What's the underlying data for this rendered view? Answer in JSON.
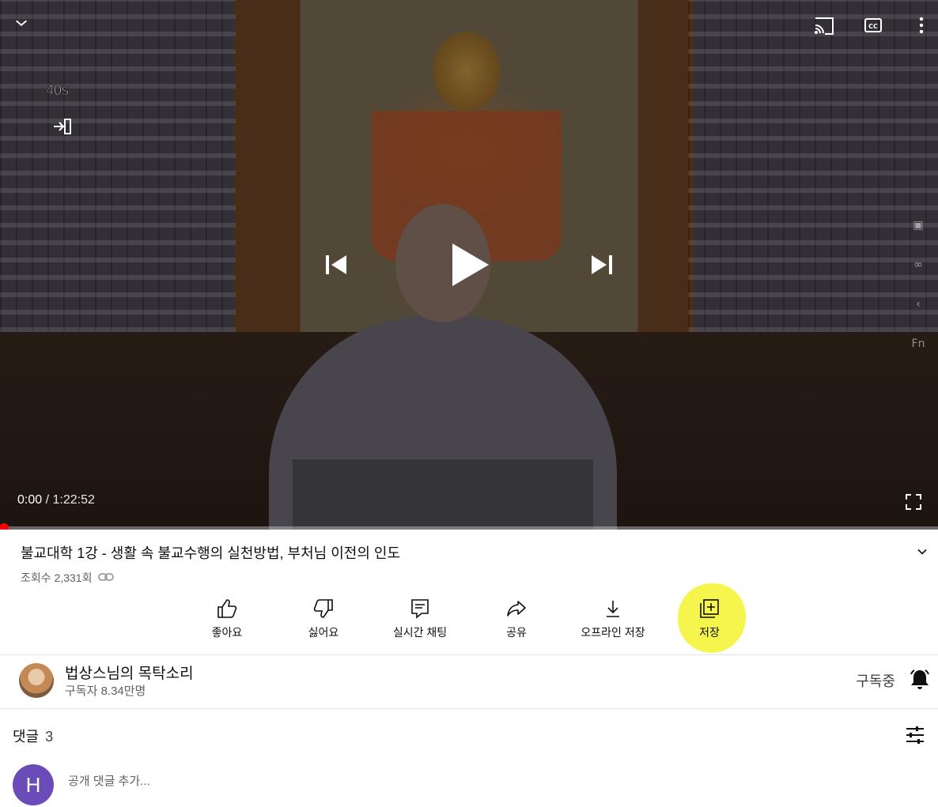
{
  "player": {
    "current_time": "0:00",
    "separator": " / ",
    "duration": "1:22:52",
    "seek_hint": "40s",
    "progress_fraction": 0.0,
    "icons": {
      "collapse": "chevron-down-icon",
      "cast": "cast-icon",
      "captions": "cc-icon",
      "more": "more-vert-icon",
      "previous": "skip-previous-icon",
      "play": "play-icon",
      "next": "skip-next-icon",
      "fullscreen": "fullscreen-icon"
    },
    "side_tools": [
      "Fn"
    ]
  },
  "video": {
    "title": "불교대학 1강 - 생활 속 불교수행의 실천방법, 부처님 이전의 인도",
    "views": "조회수 2,331회"
  },
  "actions": [
    {
      "label": "좋아요",
      "icon": "thumb-up-icon"
    },
    {
      "label": "싫어요",
      "icon": "thumb-down-icon"
    },
    {
      "label": "실시간 채팅",
      "icon": "live-chat-icon"
    },
    {
      "label": "공유",
      "icon": "share-icon"
    },
    {
      "label": "오프라인 저장",
      "icon": "download-icon"
    },
    {
      "label": "저장",
      "icon": "playlist-add-icon"
    }
  ],
  "channel": {
    "name": "법상스님의 목탁소리",
    "subscribers": "구독자 8.34만명",
    "subscribed_label": "구독중"
  },
  "comments": {
    "title": "댓글",
    "count": "3",
    "avatar_initial": "H",
    "placeholder": "공개 댓글 추가..."
  },
  "colors": {
    "progress": "#ff0000",
    "highlight": "#f4f43a",
    "avatar": "#6a4bb8"
  }
}
